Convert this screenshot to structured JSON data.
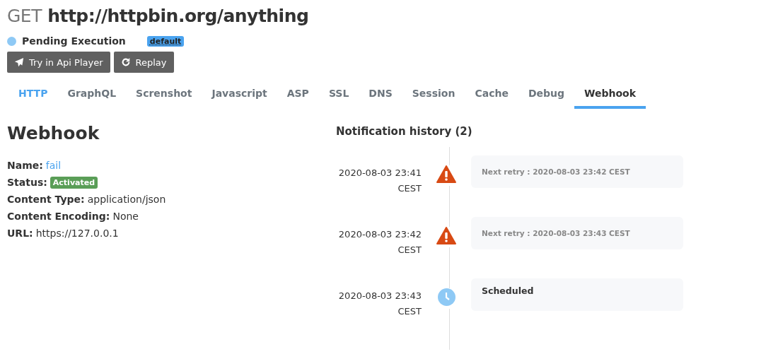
{
  "request": {
    "method": "GET",
    "url": "http://httpbin.org/anything"
  },
  "status": {
    "label": "Pending Execution",
    "color": "#8ec9f5",
    "tag": "default"
  },
  "buttons": [
    {
      "label": "Try in Api Player",
      "kind": "send"
    },
    {
      "label": "Replay",
      "kind": "replay"
    }
  ],
  "tabs": [
    {
      "label": "HTTP",
      "selected": false,
      "highlight": true
    },
    {
      "label": "GraphQL",
      "selected": false,
      "highlight": false
    },
    {
      "label": "Screnshot",
      "selected": false,
      "highlight": false
    },
    {
      "label": "Javascript",
      "selected": false,
      "highlight": false
    },
    {
      "label": "ASP",
      "selected": false,
      "highlight": false
    },
    {
      "label": "SSL",
      "selected": false,
      "highlight": false
    },
    {
      "label": "DNS",
      "selected": false,
      "highlight": false
    },
    {
      "label": "Session",
      "selected": false,
      "highlight": false
    },
    {
      "label": "Cache",
      "selected": false,
      "highlight": false
    },
    {
      "label": "Debug",
      "selected": false,
      "highlight": false
    },
    {
      "label": "Webhook",
      "selected": true,
      "highlight": false
    }
  ],
  "webhook": {
    "title": "Webhook",
    "fields": [
      {
        "label": "Name:",
        "value": "fail",
        "kind": "link"
      },
      {
        "label": "Status:",
        "value": "Activated",
        "kind": "badge"
      },
      {
        "label": "Content Type:",
        "value": "application/json",
        "kind": "text"
      },
      {
        "label": "Content Encoding:",
        "value": "None",
        "kind": "text"
      },
      {
        "label": "URL:",
        "value": "https://127.0.0.1",
        "kind": "text"
      }
    ]
  },
  "history": {
    "title": "Notification history (2)",
    "events": [
      {
        "date": "2020-08-03 23:41",
        "zone": "CEST",
        "kind": "warning",
        "message": "Next retry : 2020-08-03 23:42 CEST"
      },
      {
        "date": "2020-08-03 23:42",
        "zone": "CEST",
        "kind": "warning",
        "message": "Next retry : 2020-08-03 23:43 CEST"
      },
      {
        "date": "2020-08-03 23:43",
        "zone": "CEST",
        "kind": "scheduled",
        "message": "Scheduled"
      }
    ]
  }
}
